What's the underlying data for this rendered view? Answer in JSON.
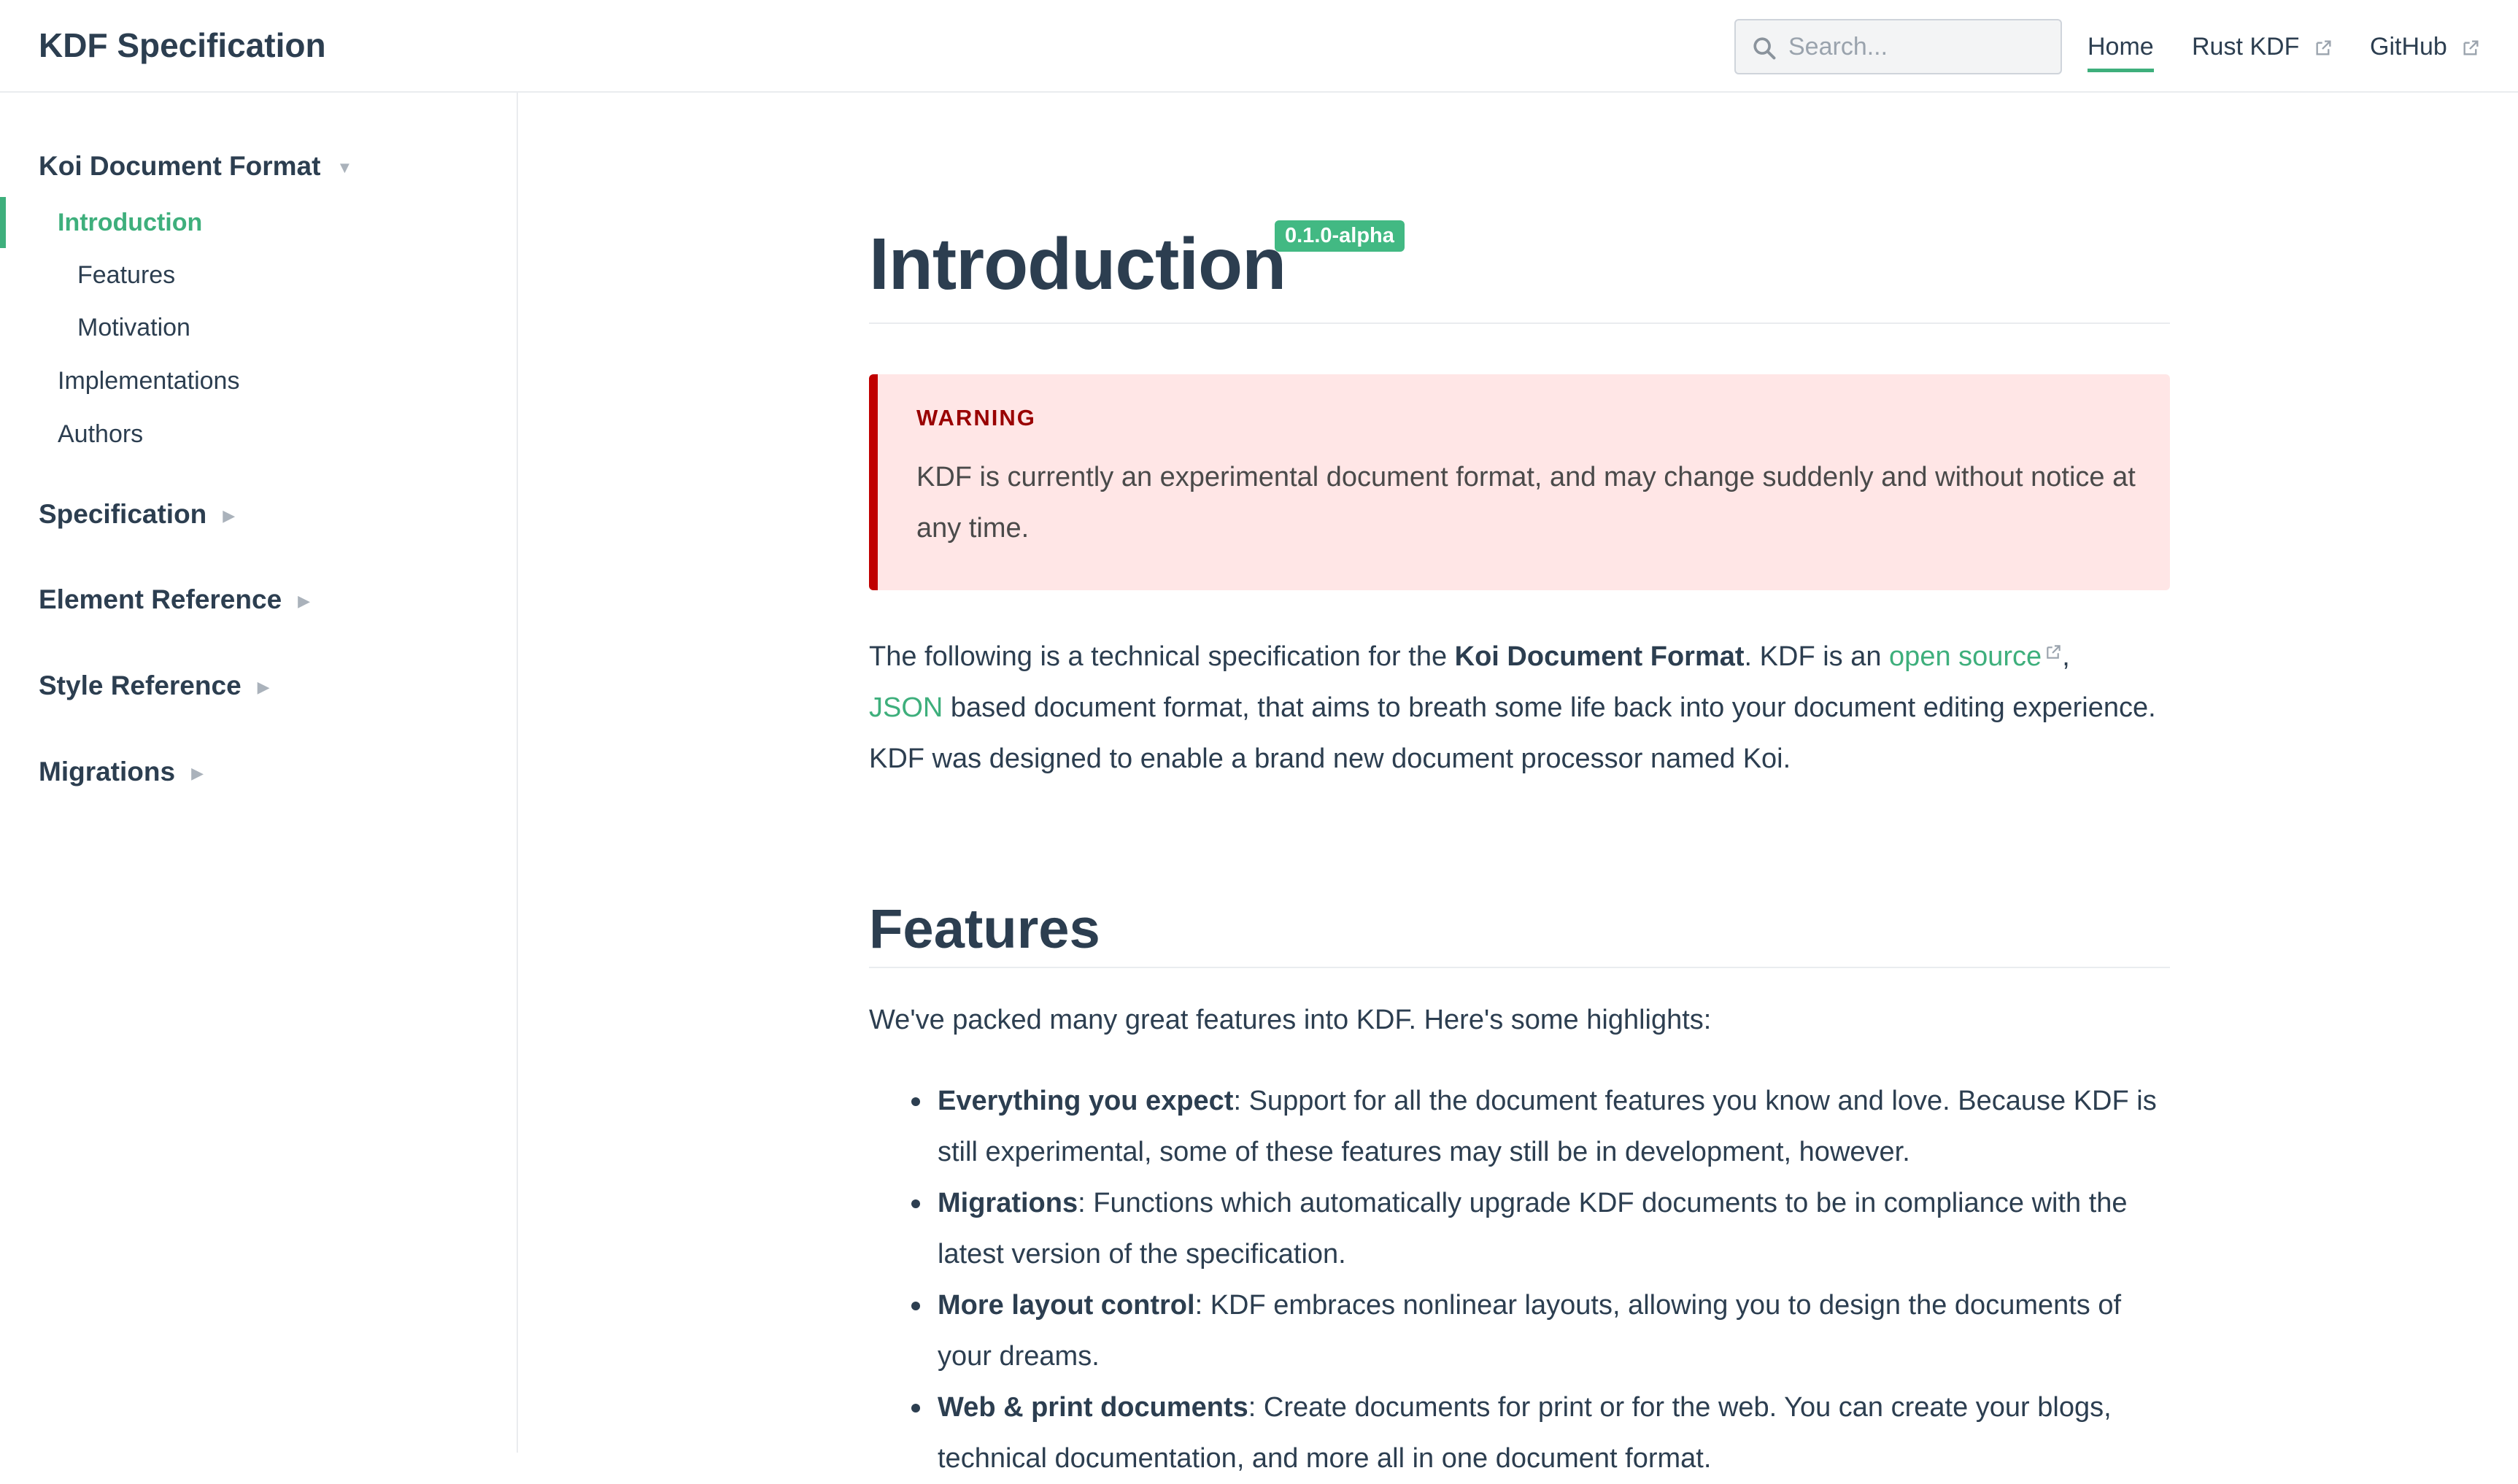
{
  "header": {
    "site_title": "KDF Specification",
    "search_placeholder": "Search...",
    "nav": [
      {
        "label": "Home",
        "active": true
      },
      {
        "label": "Rust KDF",
        "external": true
      },
      {
        "label": "GitHub",
        "external": true
      }
    ]
  },
  "sidebar": {
    "groups": [
      {
        "label": "Koi Document Format",
        "expanded": true,
        "items": [
          {
            "label": "Introduction",
            "active": true
          },
          {
            "label": "Features"
          },
          {
            "label": "Motivation"
          },
          {
            "label": "Implementations"
          },
          {
            "label": "Authors"
          }
        ]
      },
      {
        "label": "Specification",
        "expanded": false
      },
      {
        "label": "Element Reference",
        "expanded": false
      },
      {
        "label": "Style Reference",
        "expanded": false
      },
      {
        "label": "Migrations",
        "expanded": false
      }
    ]
  },
  "main": {
    "title": "Introduction",
    "version_badge": "0.1.0-alpha",
    "warning": {
      "title": "WARNING",
      "text": "KDF is currently an experimental document format, and may change suddenly and without notice at any time."
    },
    "intro": {
      "part1": "The following is a technical specification for the ",
      "bold": "Koi Document Format",
      "part2": ". KDF is an ",
      "link_open_source": "open source",
      "part3": ",",
      "link_json": "JSON",
      "part4": " based document format, that aims to breath some life back into your document editing experience. KDF was designed to enable a brand new document processor named Koi."
    },
    "features_heading": "Features",
    "features_intro": "We've packed many great features into KDF. Here's some highlights:",
    "features": [
      {
        "title": "Everything you expect",
        "text": ": Support for all the document features you know and love. Because KDF is still experimental, some of these features may still be in development, however."
      },
      {
        "title": "Migrations",
        "text": ": Functions which automatically upgrade KDF documents to be in compliance with the latest version of the specification."
      },
      {
        "title": "More layout control",
        "text": ": KDF embraces nonlinear layouts, allowing you to design the documents of your dreams."
      },
      {
        "title": "Web & print documents",
        "text": ": Create documents for print or for the web. You can create your blogs, technical documentation, and more all in one document format."
      }
    ]
  },
  "colors": {
    "accent": "#3eaf7c",
    "badge": "#42b983",
    "warning_bg": "#ffe6e6",
    "warning_border": "#c00000",
    "warning_title": "#990000",
    "text": "#2c3e50"
  },
  "icons": {
    "search": "search-icon",
    "external": "external-link-icon",
    "expanded": "triangle-down-icon",
    "collapsed": "triangle-right-icon"
  }
}
